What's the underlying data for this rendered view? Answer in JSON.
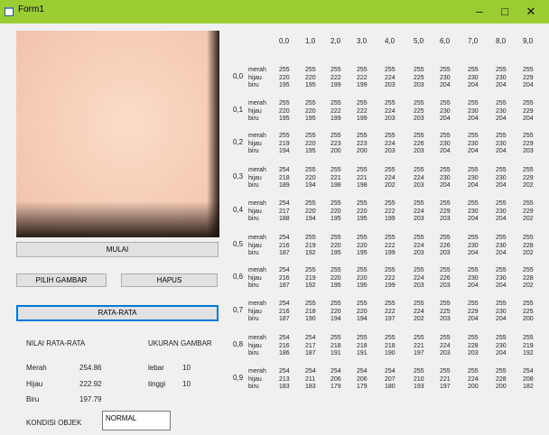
{
  "window": {
    "title": "Form1",
    "minimize": "–",
    "maximize": "□",
    "close": "✕"
  },
  "buttons": {
    "mulai": "MULAI",
    "pilih_gambar": "PILIH GAMBAR",
    "hapus": "HAPUS",
    "rata_rata": "RATA-RATA"
  },
  "labels": {
    "nilai_rata_rata": "NILAI RATA-RATA",
    "ukuran_gambar": "UKURAN GAMBAR",
    "merah": "Merah",
    "merah_value": "254.86",
    "hijau": "Hijau",
    "hijau_value": "222.92",
    "biru": "Biru",
    "biru_value": "197.79",
    "lebar": "lebar",
    "lebar_value": "10",
    "tinggi": "tinggi",
    "tinggi_value": "10",
    "kondisi_objek": "KONDISI OBJEK"
  },
  "kondisi_value": "NORMAL",
  "grid": {
    "columns": [
      "0,0",
      "1,0",
      "2,0",
      "3,0",
      "4,0",
      "5,0",
      "6,0",
      "7,0",
      "8,0",
      "9,0"
    ],
    "channel_names": [
      "merah",
      "hijau",
      "biru"
    ],
    "rows": [
      {
        "label": "0,0",
        "merah": [
          "255",
          "255",
          "255",
          "255",
          "255",
          "255",
          "255",
          "255",
          "255",
          "255"
        ],
        "hijau": [
          "220",
          "220",
          "222",
          "222",
          "224",
          "225",
          "230",
          "230",
          "230",
          "229"
        ],
        "biru": [
          "195",
          "195",
          "199",
          "199",
          "203",
          "203",
          "204",
          "204",
          "204",
          "204"
        ]
      },
      {
        "label": "0,1",
        "merah": [
          "255",
          "255",
          "255",
          "255",
          "255",
          "255",
          "255",
          "255",
          "255",
          "255"
        ],
        "hijau": [
          "220",
          "220",
          "222",
          "222",
          "224",
          "225",
          "230",
          "230",
          "230",
          "229"
        ],
        "biru": [
          "195",
          "195",
          "199",
          "199",
          "203",
          "203",
          "204",
          "204",
          "204",
          "204"
        ]
      },
      {
        "label": "0,2",
        "merah": [
          "255",
          "255",
          "255",
          "255",
          "255",
          "255",
          "255",
          "255",
          "255",
          "255"
        ],
        "hijau": [
          "219",
          "220",
          "223",
          "223",
          "224",
          "226",
          "230",
          "230",
          "230",
          "229"
        ],
        "biru": [
          "194",
          "195",
          "200",
          "200",
          "203",
          "203",
          "204",
          "204",
          "204",
          "203"
        ]
      },
      {
        "label": "0,3",
        "merah": [
          "254",
          "255",
          "255",
          "255",
          "255",
          "255",
          "255",
          "255",
          "255",
          "255"
        ],
        "hijau": [
          "218",
          "220",
          "221",
          "221",
          "224",
          "224",
          "230",
          "230",
          "230",
          "229"
        ],
        "biru": [
          "189",
          "194",
          "198",
          "198",
          "202",
          "203",
          "204",
          "204",
          "204",
          "202"
        ]
      },
      {
        "label": "0,4",
        "merah": [
          "254",
          "255",
          "255",
          "255",
          "255",
          "255",
          "255",
          "255",
          "255",
          "255"
        ],
        "hijau": [
          "217",
          "220",
          "220",
          "220",
          "222",
          "224",
          "229",
          "230",
          "230",
          "229"
        ],
        "biru": [
          "188",
          "194",
          "195",
          "195",
          "199",
          "203",
          "203",
          "204",
          "204",
          "202"
        ]
      },
      {
        "label": "0,5",
        "merah": [
          "254",
          "255",
          "255",
          "255",
          "255",
          "255",
          "255",
          "255",
          "255",
          "255"
        ],
        "hijau": [
          "216",
          "219",
          "220",
          "220",
          "222",
          "224",
          "226",
          "230",
          "230",
          "228"
        ],
        "biru": [
          "187",
          "192",
          "195",
          "195",
          "199",
          "203",
          "203",
          "204",
          "204",
          "202"
        ]
      },
      {
        "label": "0,6",
        "merah": [
          "254",
          "255",
          "255",
          "255",
          "255",
          "255",
          "255",
          "255",
          "255",
          "255"
        ],
        "hijau": [
          "216",
          "219",
          "220",
          "220",
          "222",
          "224",
          "226",
          "230",
          "230",
          "228"
        ],
        "biru": [
          "187",
          "192",
          "195",
          "195",
          "199",
          "203",
          "203",
          "204",
          "204",
          "202"
        ]
      },
      {
        "label": "0,7",
        "merah": [
          "254",
          "255",
          "255",
          "255",
          "255",
          "255",
          "255",
          "255",
          "255",
          "255"
        ],
        "hijau": [
          "216",
          "218",
          "220",
          "220",
          "222",
          "224",
          "225",
          "229",
          "230",
          "225"
        ],
        "biru": [
          "187",
          "190",
          "194",
          "194",
          "197",
          "202",
          "203",
          "204",
          "204",
          "200"
        ]
      },
      {
        "label": "0,8",
        "merah": [
          "254",
          "254",
          "255",
          "255",
          "255",
          "255",
          "255",
          "255",
          "255",
          "255"
        ],
        "hijau": [
          "216",
          "217",
          "218",
          "218",
          "218",
          "221",
          "224",
          "228",
          "230",
          "219"
        ],
        "biru": [
          "186",
          "187",
          "191",
          "191",
          "190",
          "197",
          "203",
          "203",
          "204",
          "192"
        ]
      },
      {
        "label": "0,9",
        "merah": [
          "254",
          "254",
          "254",
          "254",
          "254",
          "255",
          "255",
          "255",
          "255",
          "254"
        ],
        "hijau": [
          "213",
          "211",
          "206",
          "206",
          "207",
          "210",
          "221",
          "224",
          "228",
          "208"
        ],
        "biru": [
          "183",
          "183",
          "179",
          "179",
          "180",
          "193",
          "197",
          "200",
          "200",
          "182"
        ]
      }
    ]
  }
}
